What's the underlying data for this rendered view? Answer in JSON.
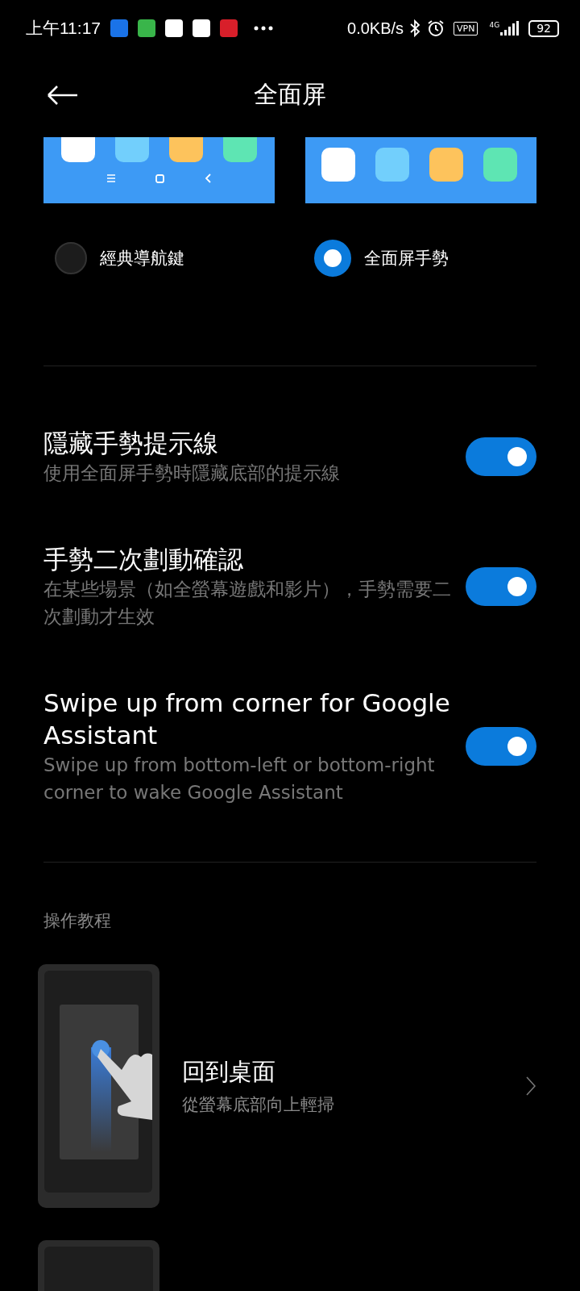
{
  "status_bar": {
    "time": "上午11:17",
    "net_speed": "0.0KB/s",
    "vpn": "VPN",
    "network": "4G",
    "battery": "92"
  },
  "header": {
    "title": "全面屏"
  },
  "nav_modes": [
    {
      "label": "經典導航鍵",
      "kind": "buttons",
      "selected": false
    },
    {
      "label": "全面屏手勢",
      "kind": "gestures",
      "selected": true
    }
  ],
  "toggles": [
    {
      "title": "隱藏手勢提示線",
      "subtitle": "使用全面屏手勢時隱藏底部的提示線",
      "on": true
    },
    {
      "title": "手勢二次劃動確認",
      "subtitle": "在某些場景（如全螢幕遊戲和影片），手勢需要二次劃動才生效",
      "on": true
    },
    {
      "title": "Swipe up from corner for Google Assistant",
      "subtitle": "Swipe up from bottom-left or bottom-right corner to wake Google Assistant",
      "on": true
    }
  ],
  "section": {
    "label": "操作教程"
  },
  "tutorials": [
    {
      "kind": "full",
      "title": "回到桌面",
      "subtitle": "從螢幕底部向上輕掃"
    },
    {
      "kind": "partial"
    }
  ]
}
